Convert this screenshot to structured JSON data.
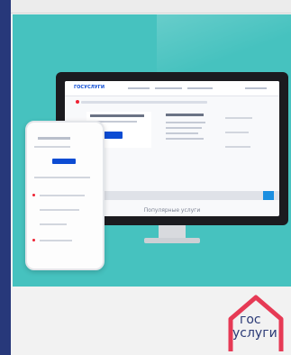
{
  "screen": {
    "nav_logo": "ГОСУСЛУГИ",
    "caption": "Популярные услуги"
  },
  "logo": {
    "line1": "гос",
    "line2": "услуги",
    "outline_color": "#e63a55",
    "text_color": "#2b3a76"
  },
  "colors": {
    "frame": "#46c2bf",
    "stripe": "#27387a",
    "accent_blue": "#0d4cd3"
  }
}
